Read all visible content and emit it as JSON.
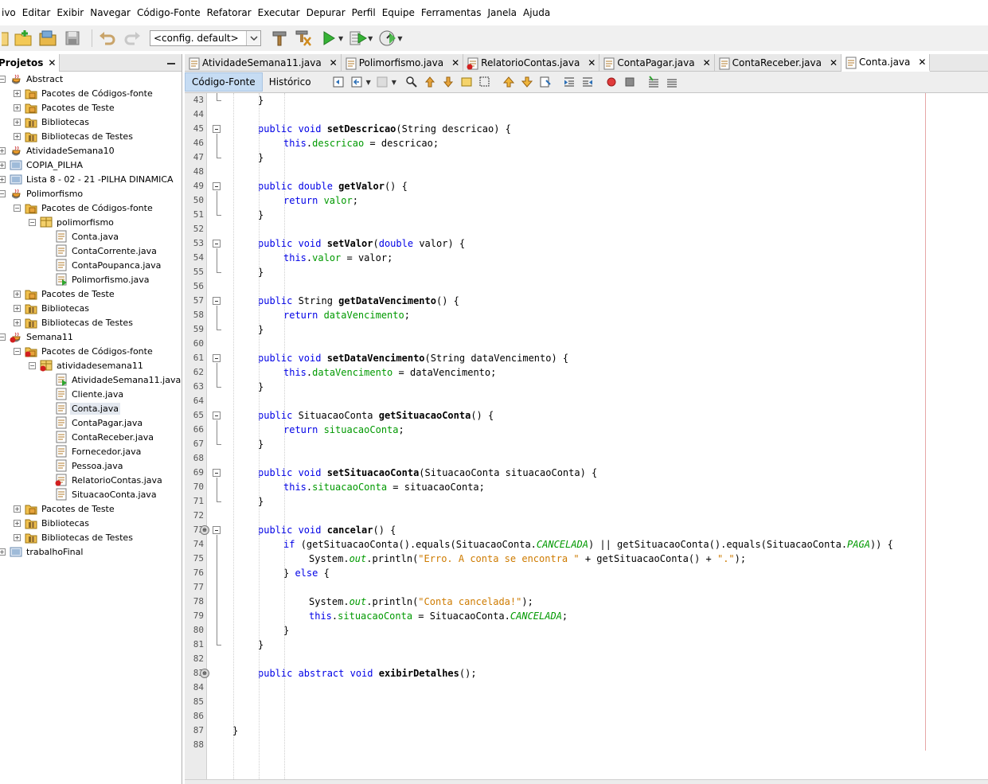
{
  "menu": [
    "ivo",
    "Editar",
    "Exibir",
    "Navegar",
    "Código-Fonte",
    "Refatorar",
    "Executar",
    "Depurar",
    "Perfil",
    "Equipe",
    "Ferramentas",
    "Janela",
    "Ajuda"
  ],
  "toolbar": {
    "config": "<config. default>",
    "icons": [
      "new-file-icon",
      "new-project-icon",
      "open-project-icon",
      "save-all-icon",
      "undo-icon",
      "redo-icon",
      "build-icon",
      "clean-build-icon",
      "run-icon",
      "debug-icon",
      "profile-icon"
    ]
  },
  "projects_panel": {
    "title": "Projetos",
    "close": "✕",
    "minimize": "—",
    "tree": [
      {
        "label": "Abstract",
        "depth": 0,
        "icon": "java-project-icon",
        "expanded": true
      },
      {
        "label": "Pacotes de Códigos-fonte",
        "depth": 1,
        "icon": "source-package-icon",
        "expanded": false
      },
      {
        "label": "Pacotes de Teste",
        "depth": 1,
        "icon": "test-package-icon",
        "expanded": false
      },
      {
        "label": "Bibliotecas",
        "depth": 1,
        "icon": "library-icon",
        "expanded": false
      },
      {
        "label": "Bibliotecas de Testes",
        "depth": 1,
        "icon": "library-icon",
        "expanded": false
      },
      {
        "label": "AtividadeSemana10",
        "depth": 0,
        "icon": "java-project-icon",
        "expanded": false
      },
      {
        "label": "COPIA_PILHA",
        "depth": 0,
        "icon": "project-icon",
        "expanded": false
      },
      {
        "label": "Lista 8 - 02 - 21 -PILHA DINAMICA",
        "depth": 0,
        "icon": "project-icon",
        "expanded": false
      },
      {
        "label": "Polimorfismo",
        "depth": 0,
        "icon": "java-project-icon",
        "expanded": true
      },
      {
        "label": "Pacotes de Códigos-fonte",
        "depth": 1,
        "icon": "source-package-icon",
        "expanded": true
      },
      {
        "label": "polimorfismo",
        "depth": 2,
        "icon": "package-icon",
        "expanded": true
      },
      {
        "label": "Conta.java",
        "depth": 3,
        "icon": "java-file-icon",
        "leaf": true
      },
      {
        "label": "ContaCorrente.java",
        "depth": 3,
        "icon": "java-file-icon",
        "leaf": true
      },
      {
        "label": "ContaPoupanca.java",
        "depth": 3,
        "icon": "java-file-icon",
        "leaf": true
      },
      {
        "label": "Polimorfismo.java",
        "depth": 3,
        "icon": "java-main-file-icon",
        "leaf": true
      },
      {
        "label": "Pacotes de Teste",
        "depth": 1,
        "icon": "test-package-icon",
        "expanded": false
      },
      {
        "label": "Bibliotecas",
        "depth": 1,
        "icon": "library-icon",
        "expanded": false
      },
      {
        "label": "Bibliotecas de Testes",
        "depth": 1,
        "icon": "library-icon",
        "expanded": false
      },
      {
        "label": "Semana11",
        "depth": 0,
        "icon": "java-project-error-icon",
        "expanded": true
      },
      {
        "label": "Pacotes de Códigos-fonte",
        "depth": 1,
        "icon": "source-package-error-icon",
        "expanded": true
      },
      {
        "label": "atividadesemana11",
        "depth": 2,
        "icon": "package-error-icon",
        "expanded": true
      },
      {
        "label": "AtividadeSemana11.java",
        "depth": 3,
        "icon": "java-main-file-icon",
        "leaf": true
      },
      {
        "label": "Cliente.java",
        "depth": 3,
        "icon": "java-file-icon",
        "leaf": true
      },
      {
        "label": "Conta.java",
        "depth": 3,
        "icon": "java-file-icon",
        "leaf": true,
        "selected": true
      },
      {
        "label": "ContaPagar.java",
        "depth": 3,
        "icon": "java-file-icon",
        "leaf": true
      },
      {
        "label": "ContaReceber.java",
        "depth": 3,
        "icon": "java-file-icon",
        "leaf": true
      },
      {
        "label": "Fornecedor.java",
        "depth": 3,
        "icon": "java-file-icon",
        "leaf": true
      },
      {
        "label": "Pessoa.java",
        "depth": 3,
        "icon": "java-file-icon",
        "leaf": true
      },
      {
        "label": "RelatorioContas.java",
        "depth": 3,
        "icon": "java-file-error-icon",
        "leaf": true
      },
      {
        "label": "SituacaoConta.java",
        "depth": 3,
        "icon": "java-file-icon",
        "leaf": true
      },
      {
        "label": "Pacotes de Teste",
        "depth": 1,
        "icon": "test-package-icon",
        "expanded": false
      },
      {
        "label": "Bibliotecas",
        "depth": 1,
        "icon": "library-icon",
        "expanded": false
      },
      {
        "label": "Bibliotecas de Testes",
        "depth": 1,
        "icon": "library-icon",
        "expanded": false
      },
      {
        "label": "trabalhoFinal",
        "depth": 0,
        "icon": "project-icon",
        "expanded": false
      }
    ]
  },
  "editor": {
    "tabs": [
      {
        "label": "AtividadeSemana11.java",
        "active": false,
        "error": false
      },
      {
        "label": "Polimorfismo.java",
        "active": false,
        "error": false
      },
      {
        "label": "RelatorioContas.java",
        "active": false,
        "error": true
      },
      {
        "label": "ContaPagar.java",
        "active": false,
        "error": false
      },
      {
        "label": "ContaReceber.java",
        "active": false,
        "error": false
      },
      {
        "label": "Conta.java",
        "active": true,
        "error": false
      }
    ],
    "view_tabs": [
      "Código-Fonte",
      "Histórico"
    ],
    "first_line": 43,
    "lines": [
      {
        "n": 43,
        "indent": 4,
        "parts": [
          [
            "p",
            "}"
          ]
        ],
        "fold": "end"
      },
      {
        "n": 44,
        "indent": 0,
        "parts": []
      },
      {
        "n": 45,
        "indent": 4,
        "parts": [
          [
            "k",
            "public void "
          ],
          [
            "m",
            "setDescricao"
          ],
          [
            "p",
            "(String descricao) {"
          ]
        ],
        "fold": "start"
      },
      {
        "n": 46,
        "indent": 8,
        "parts": [
          [
            "k",
            "this"
          ],
          [
            "p",
            "."
          ],
          [
            "f",
            "descricao"
          ],
          [
            "p",
            " = descricao;"
          ]
        ]
      },
      {
        "n": 47,
        "indent": 4,
        "parts": [
          [
            "p",
            "}"
          ]
        ],
        "fold": "end"
      },
      {
        "n": 48,
        "indent": 0,
        "parts": []
      },
      {
        "n": 49,
        "indent": 4,
        "parts": [
          [
            "k",
            "public double "
          ],
          [
            "m",
            "getValor"
          ],
          [
            "p",
            "() {"
          ]
        ],
        "fold": "start"
      },
      {
        "n": 50,
        "indent": 8,
        "parts": [
          [
            "k",
            "return "
          ],
          [
            "f",
            "valor"
          ],
          [
            "p",
            ";"
          ]
        ]
      },
      {
        "n": 51,
        "indent": 4,
        "parts": [
          [
            "p",
            "}"
          ]
        ],
        "fold": "end"
      },
      {
        "n": 52,
        "indent": 0,
        "parts": []
      },
      {
        "n": 53,
        "indent": 4,
        "parts": [
          [
            "k",
            "public void "
          ],
          [
            "m",
            "setValor"
          ],
          [
            "p",
            "("
          ],
          [
            "k",
            "double"
          ],
          [
            "p",
            " valor) {"
          ]
        ],
        "fold": "start"
      },
      {
        "n": 54,
        "indent": 8,
        "parts": [
          [
            "k",
            "this"
          ],
          [
            "p",
            "."
          ],
          [
            "f",
            "valor"
          ],
          [
            "p",
            " = valor;"
          ]
        ]
      },
      {
        "n": 55,
        "indent": 4,
        "parts": [
          [
            "p",
            "}"
          ]
        ],
        "fold": "end"
      },
      {
        "n": 56,
        "indent": 0,
        "parts": []
      },
      {
        "n": 57,
        "indent": 4,
        "parts": [
          [
            "k",
            "public "
          ],
          [
            "p",
            "String "
          ],
          [
            "m",
            "getDataVencimento"
          ],
          [
            "p",
            "() {"
          ]
        ],
        "fold": "start"
      },
      {
        "n": 58,
        "indent": 8,
        "parts": [
          [
            "k",
            "return "
          ],
          [
            "f",
            "dataVencimento"
          ],
          [
            "p",
            ";"
          ]
        ]
      },
      {
        "n": 59,
        "indent": 4,
        "parts": [
          [
            "p",
            "}"
          ]
        ],
        "fold": "end"
      },
      {
        "n": 60,
        "indent": 0,
        "parts": []
      },
      {
        "n": 61,
        "indent": 4,
        "parts": [
          [
            "k",
            "public void "
          ],
          [
            "m",
            "setDataVencimento"
          ],
          [
            "p",
            "(String dataVencimento) {"
          ]
        ],
        "fold": "start"
      },
      {
        "n": 62,
        "indent": 8,
        "parts": [
          [
            "k",
            "this"
          ],
          [
            "p",
            "."
          ],
          [
            "f",
            "dataVencimento"
          ],
          [
            "p",
            " = dataVencimento;"
          ]
        ]
      },
      {
        "n": 63,
        "indent": 4,
        "parts": [
          [
            "p",
            "}"
          ]
        ],
        "fold": "end"
      },
      {
        "n": 64,
        "indent": 0,
        "parts": []
      },
      {
        "n": 65,
        "indent": 4,
        "parts": [
          [
            "k",
            "public "
          ],
          [
            "p",
            "SituacaoConta "
          ],
          [
            "m",
            "getSituacaoConta"
          ],
          [
            "p",
            "() {"
          ]
        ],
        "fold": "start"
      },
      {
        "n": 66,
        "indent": 8,
        "parts": [
          [
            "k",
            "return "
          ],
          [
            "f",
            "situacaoConta"
          ],
          [
            "p",
            ";"
          ]
        ]
      },
      {
        "n": 67,
        "indent": 4,
        "parts": [
          [
            "p",
            "}"
          ]
        ],
        "fold": "end"
      },
      {
        "n": 68,
        "indent": 0,
        "parts": []
      },
      {
        "n": 69,
        "indent": 4,
        "parts": [
          [
            "k",
            "public void "
          ],
          [
            "m",
            "setSituacaoConta"
          ],
          [
            "p",
            "(SituacaoConta situacaoConta) {"
          ]
        ],
        "fold": "start"
      },
      {
        "n": 70,
        "indent": 8,
        "parts": [
          [
            "k",
            "this"
          ],
          [
            "p",
            "."
          ],
          [
            "f",
            "situacaoConta"
          ],
          [
            "p",
            " = situacaoConta;"
          ]
        ]
      },
      {
        "n": 71,
        "indent": 4,
        "parts": [
          [
            "p",
            "}"
          ]
        ],
        "fold": "end"
      },
      {
        "n": 72,
        "indent": 0,
        "parts": []
      },
      {
        "n": 73,
        "indent": 4,
        "parts": [
          [
            "k",
            "public void "
          ],
          [
            "m",
            "cancelar"
          ],
          [
            "p",
            "() {"
          ]
        ],
        "fold": "start",
        "annotation": true
      },
      {
        "n": 74,
        "indent": 8,
        "parts": [
          [
            "k",
            "if "
          ],
          [
            "p",
            "(getSituacaoConta().equals(SituacaoConta."
          ],
          [
            "c",
            "CANCELADA"
          ],
          [
            "p",
            ") || getSituacaoConta().equals(SituacaoConta."
          ],
          [
            "c",
            "PAGA"
          ],
          [
            "p",
            ")) {"
          ]
        ]
      },
      {
        "n": 75,
        "indent": 12,
        "parts": [
          [
            "p",
            "System."
          ],
          [
            "c",
            "out"
          ],
          [
            "p",
            ".println("
          ],
          [
            "s",
            "\"Erro. A conta se encontra \""
          ],
          [
            "p",
            " + getSituacaoConta() + "
          ],
          [
            "s",
            "\".\""
          ],
          [
            "p",
            ");"
          ]
        ]
      },
      {
        "n": 76,
        "indent": 8,
        "parts": [
          [
            "p",
            "} "
          ],
          [
            "k",
            "else"
          ],
          [
            "p",
            " {"
          ]
        ]
      },
      {
        "n": 77,
        "indent": 0,
        "parts": []
      },
      {
        "n": 78,
        "indent": 12,
        "parts": [
          [
            "p",
            "System."
          ],
          [
            "c",
            "out"
          ],
          [
            "p",
            ".println("
          ],
          [
            "s",
            "\"Conta cancelada!\""
          ],
          [
            "p",
            ");"
          ]
        ]
      },
      {
        "n": 79,
        "indent": 12,
        "parts": [
          [
            "k",
            "this"
          ],
          [
            "p",
            "."
          ],
          [
            "f",
            "situacaoConta"
          ],
          [
            "p",
            " = SituacaoConta."
          ],
          [
            "c",
            "CANCELADA"
          ],
          [
            "p",
            ";"
          ]
        ]
      },
      {
        "n": 80,
        "indent": 8,
        "parts": [
          [
            "p",
            "}"
          ]
        ]
      },
      {
        "n": 81,
        "indent": 4,
        "parts": [
          [
            "p",
            "}"
          ]
        ],
        "fold": "end"
      },
      {
        "n": 82,
        "indent": 0,
        "parts": []
      },
      {
        "n": 83,
        "indent": 4,
        "parts": [
          [
            "k",
            "public abstract void "
          ],
          [
            "m",
            "exibirDetalhes"
          ],
          [
            "p",
            "();"
          ]
        ],
        "annotation": true
      },
      {
        "n": 84,
        "indent": 0,
        "parts": []
      },
      {
        "n": 85,
        "indent": 0,
        "parts": []
      },
      {
        "n": 86,
        "indent": 0,
        "parts": []
      },
      {
        "n": 87,
        "indent": 0,
        "parts": [
          [
            "p",
            "}"
          ]
        ]
      },
      {
        "n": 88,
        "indent": 0,
        "parts": []
      }
    ]
  }
}
